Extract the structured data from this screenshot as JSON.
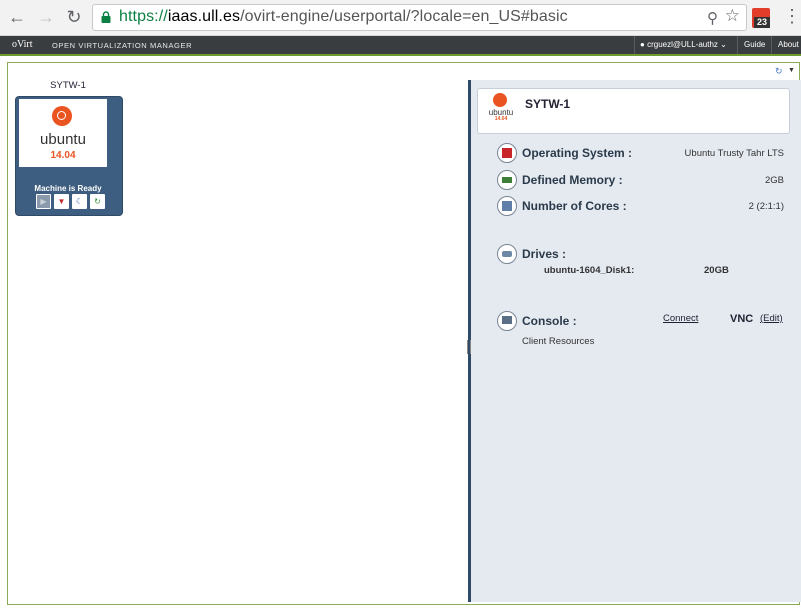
{
  "browser": {
    "url_scheme": "https://",
    "url_host": "iaas.ull.es",
    "url_path": "/ovirt-engine/userportal/?locale=en_US#basic",
    "extension_badge": "23"
  },
  "header": {
    "brand": "oVirt",
    "product": "OPEN VIRTUALIZATION MANAGER",
    "user": "crguezl@ULL-authz",
    "guide": "Guide",
    "about": "About"
  },
  "vm": {
    "name": "SYTW-1",
    "os_logo_text": "ubuntu",
    "os_version": "14.04",
    "status": "Machine is Ready"
  },
  "details": {
    "title": "SYTW-1",
    "os_label": "Operating System :",
    "os_value": "Ubuntu Trusty Tahr LTS",
    "memory_label": "Defined Memory :",
    "memory_value": "2GB",
    "cores_label": "Number of Cores :",
    "cores_value": "2 (2:1:1)",
    "drives_label": "Drives :",
    "disk_name": "ubuntu-1604_Disk1:",
    "disk_size": "20GB",
    "console_label": "Console :",
    "connect": "Connect",
    "protocol": "VNC",
    "edit": "(Edit)",
    "client_resources": "Client Resources"
  },
  "colors": {
    "accent_green": "#6c9c2e",
    "card_blue": "#3d5e80",
    "ubuntu_orange": "#e95420"
  }
}
